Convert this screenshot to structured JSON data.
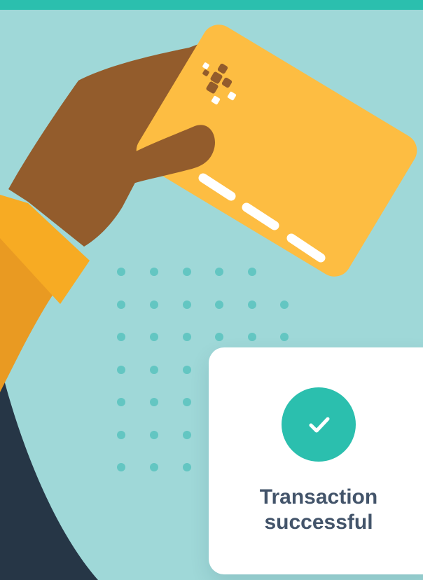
{
  "colors": {
    "background": "#9fd8d8",
    "accent": "#2bbfae",
    "card_yellow": "#fdbd42",
    "hand_brown": "#935c2c",
    "sleeve_orange": "#f7ab23",
    "dark_navy": "#263646",
    "status_text": "#43546a"
  },
  "illustration": {
    "subject": "hand-holding-credit-card-icon"
  },
  "status": {
    "icon": "checkmark-icon",
    "line1": "Transaction",
    "line2": "successful"
  }
}
